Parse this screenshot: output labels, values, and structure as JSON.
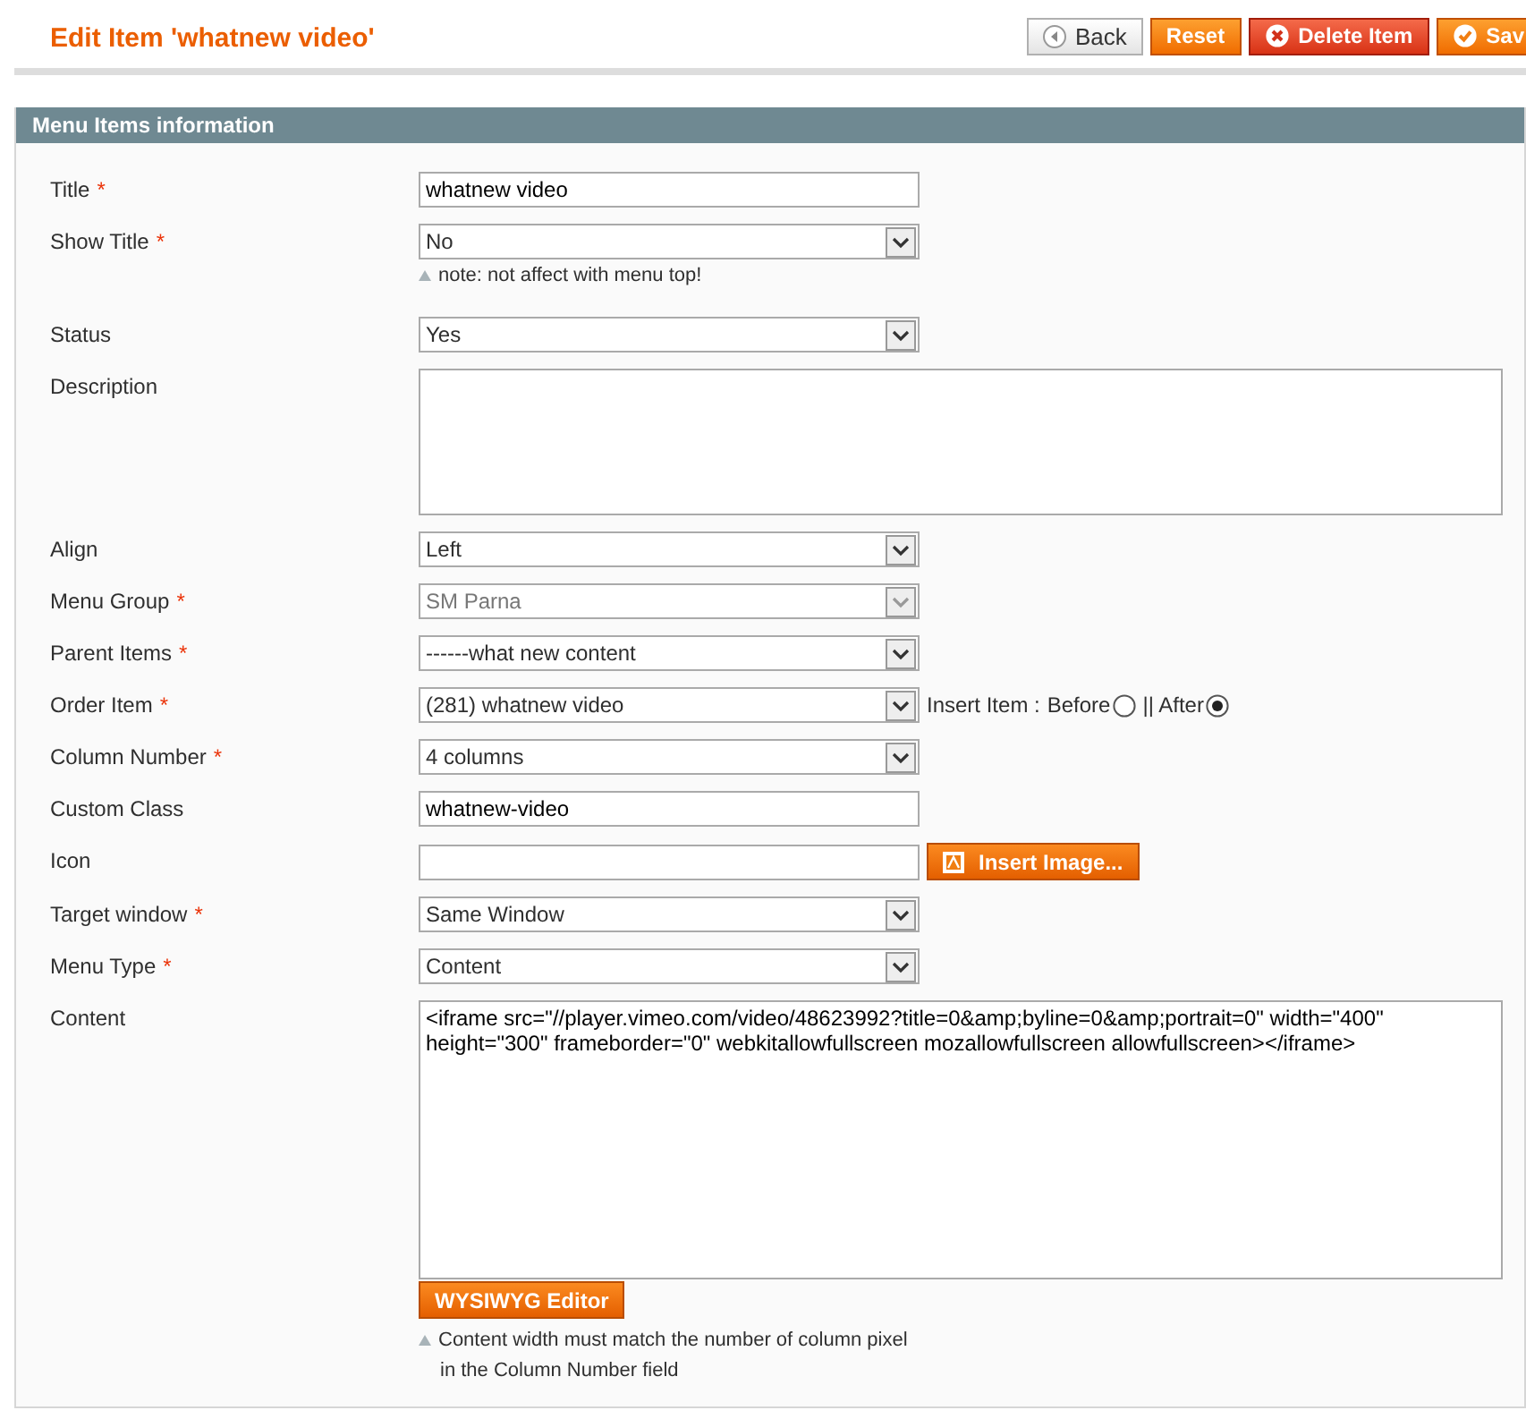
{
  "page_title": "Edit Item 'whatnew video'",
  "actions": [
    {
      "label": "Back",
      "kind": "back"
    },
    {
      "label": "Reset",
      "kind": "plain"
    },
    {
      "label": "Delete Item",
      "kind": "delete"
    },
    {
      "label": "Sav",
      "kind": "save"
    }
  ],
  "section": {
    "title": "Menu Items information"
  },
  "fields": [
    {
      "label": "Title",
      "marker": "*",
      "kind": "text",
      "value": "whatnew video"
    },
    {
      "label": "Show Title",
      "marker": "*",
      "kind": "select",
      "value": "No",
      "note": "note: not affect with menu top!"
    },
    {
      "label": "Status",
      "kind": "select",
      "value": "Yes"
    },
    {
      "label": "Description",
      "kind": "textarea"
    },
    {
      "label": "Align",
      "kind": "select",
      "value": "Left"
    },
    {
      "label": "Menu Group",
      "marker": "*",
      "kind": "select",
      "value": "SM Parna",
      "disabled": true
    },
    {
      "label": "Parent Items",
      "marker": "*",
      "kind": "select",
      "value": "------what new content"
    },
    {
      "label": "Order Item",
      "marker": "*",
      "kind": "select",
      "value": "(281) whatnew video",
      "insert": {
        "label": "Insert Item :",
        "options": [
          {
            "label": "Before",
            "selected": false
          },
          {
            "label": "|| After",
            "selected": true
          }
        ]
      }
    },
    {
      "label": "Column Number",
      "marker": "*",
      "kind": "select",
      "value": "4 columns"
    },
    {
      "label": "Custom Class",
      "kind": "text",
      "value": "whatnew-video"
    },
    {
      "label": "Icon",
      "kind": "text",
      "button": "Insert Image..."
    },
    {
      "label": "Target window",
      "marker": "*",
      "kind": "select",
      "value": "Same Window"
    },
    {
      "label": "Menu Type",
      "marker": "*",
      "kind": "select",
      "value": "Content"
    },
    {
      "label": "Content",
      "kind": "editor",
      "value": "<iframe src=\"//player.vimeo.com/video/48623992?title=0&amp;byline=0&amp;portrait=0\" width=\"400\" height=\"300\" frameborder=\"0\" webkitallowfullscreen mozallowfullscreen allowfullscreen></iframe>",
      "button": "WYSIWYG Editor",
      "notes": [
        "Content width must match the number of column pixel",
        "in the Column Number field"
      ]
    }
  ]
}
